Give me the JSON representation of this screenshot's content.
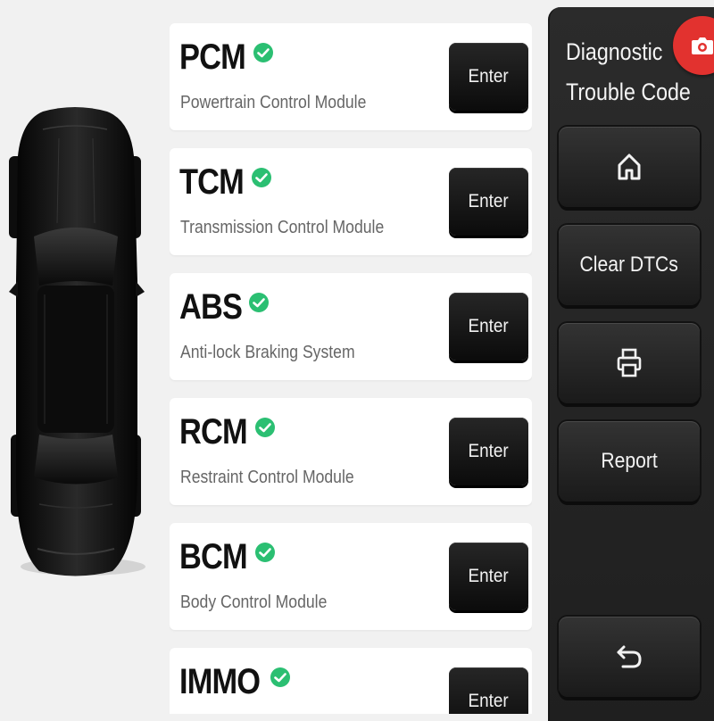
{
  "modules": [
    {
      "name": "PCM",
      "description": "Powertrain Control Module",
      "button_label": "Enter"
    },
    {
      "name": "TCM",
      "description": "Transmission Control Module",
      "button_label": "Enter"
    },
    {
      "name": "ABS",
      "description": "Anti-lock Braking System",
      "button_label": "Enter"
    },
    {
      "name": "RCM",
      "description": "Restraint Control Module",
      "button_label": "Enter"
    },
    {
      "name": "BCM",
      "description": "Body Control Module",
      "button_label": "Enter"
    },
    {
      "name": "IMMO",
      "description": "",
      "button_label": "Enter"
    }
  ],
  "panel": {
    "title_line1": "Diagnostic",
    "title_line2": "Trouble Code",
    "home_icon": "home-icon",
    "clear_label": "Clear DTCs",
    "print_icon": "printer-icon",
    "report_label": "Report",
    "back_icon": "back-arrow-icon",
    "camera_icon": "camera-icon"
  },
  "colors": {
    "status_ok": "#2bbf72",
    "camera_button": "#e2322f",
    "panel_bg": "#262626",
    "button_dark": "#141414"
  }
}
